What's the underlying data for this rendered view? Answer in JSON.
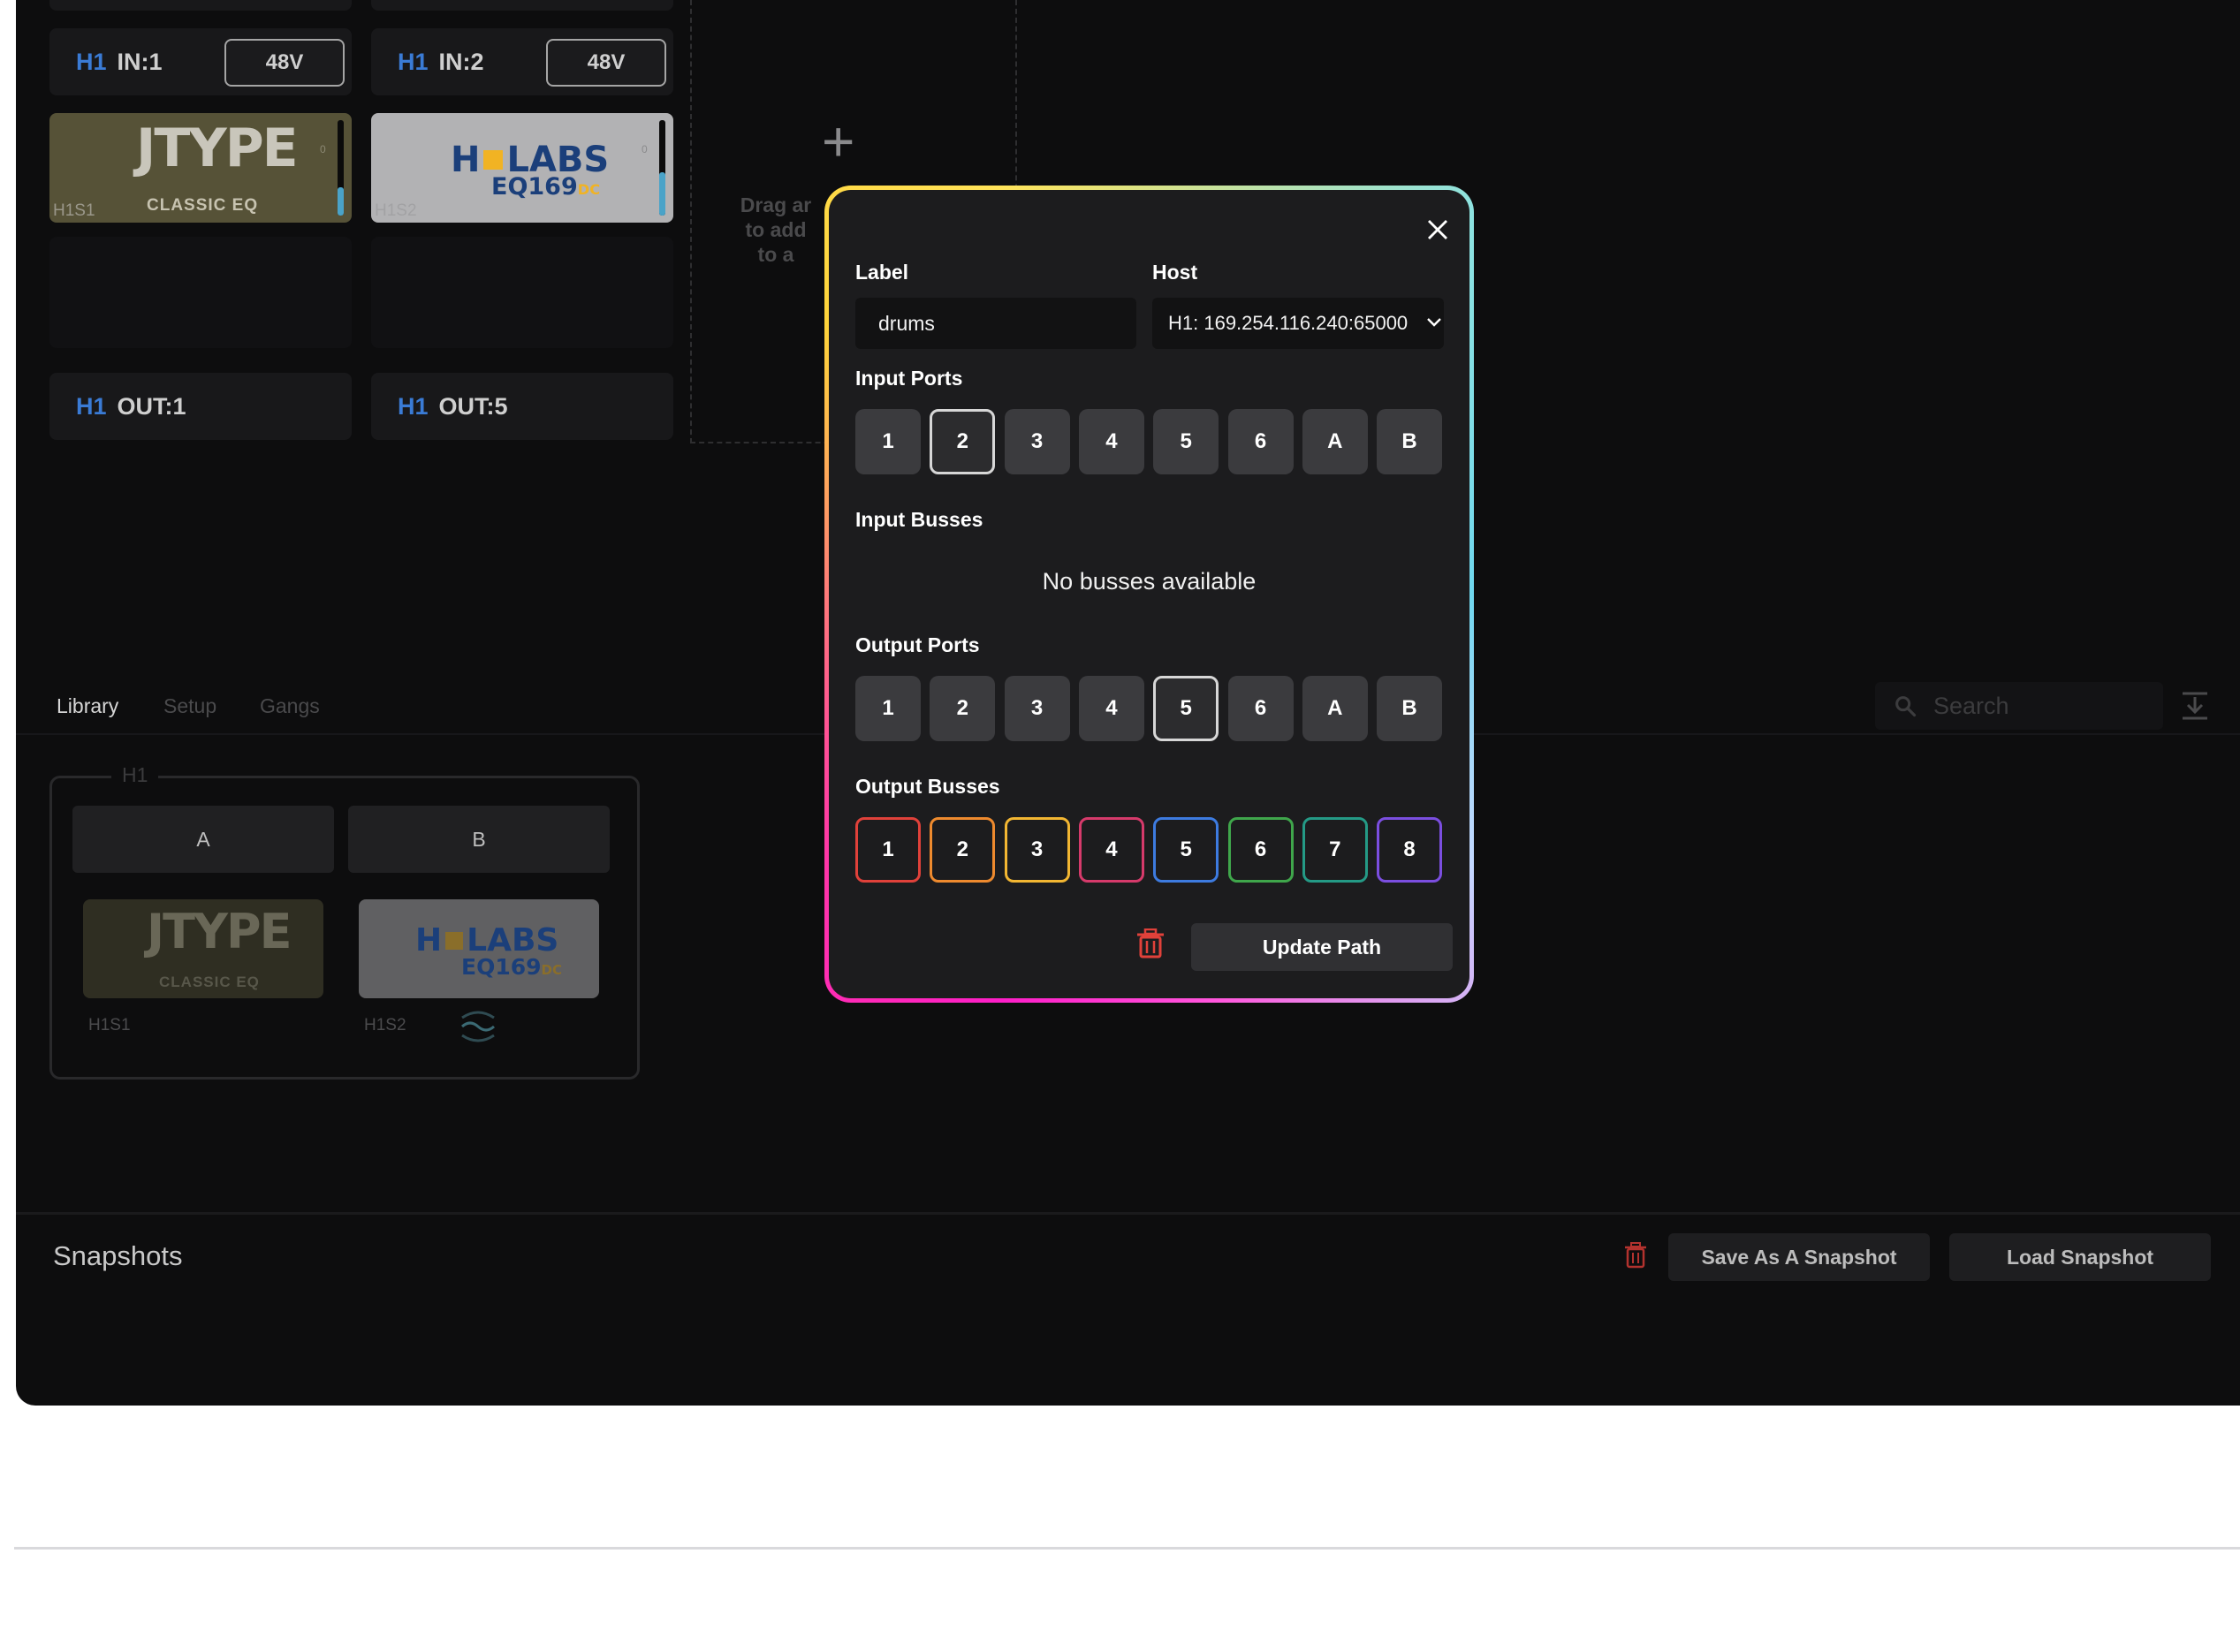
{
  "rack": {
    "inputs": [
      {
        "host": "H1",
        "name": "IN:1",
        "phantom": "48V"
      },
      {
        "host": "H1",
        "name": "IN:2",
        "phantom": "48V"
      }
    ],
    "plugins": [
      {
        "brand": "JTYPE",
        "sub": "CLASSIC EQ",
        "slot": "H1S1",
        "meter_level": 0.3,
        "meter_mark": "0"
      },
      {
        "brand_left": "H",
        "brand_right": "LABS",
        "model": "EQ169",
        "model_suffix": "DC",
        "slot": "H1S2",
        "meter_level": 0.45,
        "meter_mark": "0"
      }
    ],
    "outputs": [
      {
        "host": "H1",
        "name": "OUT:1"
      },
      {
        "host": "H1",
        "name": "OUT:5"
      }
    ],
    "drop_zone_text": [
      "Drag ar",
      "to add",
      "to a"
    ]
  },
  "tabs": [
    {
      "label": "Library",
      "active": true
    },
    {
      "label": "Setup",
      "active": false
    },
    {
      "label": "Gangs",
      "active": false
    }
  ],
  "search": {
    "placeholder": "Search"
  },
  "library": {
    "group_label": "H1",
    "gang_buttons": [
      "A",
      "B"
    ],
    "items": [
      {
        "brand": "JTYPE",
        "sub": "CLASSIC EQ",
        "slot": "H1S1"
      },
      {
        "brand_left": "H",
        "brand_right": "LABS",
        "model": "EQ169",
        "model_suffix": "DC",
        "slot": "H1S2"
      }
    ]
  },
  "snapshots": {
    "title": "Snapshots",
    "save_label": "Save As A Snapshot",
    "load_label": "Load Snapshot"
  },
  "modal": {
    "label_heading": "Label",
    "label_value": "drums",
    "host_heading": "Host",
    "host_value": "H1: 169.254.116.240:65000",
    "input_ports_heading": "Input Ports",
    "input_ports": [
      "1",
      "2",
      "3",
      "4",
      "5",
      "6",
      "A",
      "B"
    ],
    "input_ports_selected": "2",
    "input_busses_heading": "Input Busses",
    "no_busses_text": "No busses available",
    "output_ports_heading": "Output Ports",
    "output_ports": [
      "1",
      "2",
      "3",
      "4",
      "5",
      "6",
      "A",
      "B"
    ],
    "output_ports_selected": "5",
    "output_busses_heading": "Output Busses",
    "output_busses": [
      {
        "label": "1",
        "color": "#e0413a"
      },
      {
        "label": "2",
        "color": "#ee8a2e"
      },
      {
        "label": "3",
        "color": "#f2b632"
      },
      {
        "label": "4",
        "color": "#d63a6b"
      },
      {
        "label": "5",
        "color": "#3d7be0"
      },
      {
        "label": "6",
        "color": "#3fa64b"
      },
      {
        "label": "7",
        "color": "#249a86"
      },
      {
        "label": "8",
        "color": "#7b4ee0"
      }
    ],
    "update_label": "Update Path",
    "accent_delete": "#e0413a"
  }
}
